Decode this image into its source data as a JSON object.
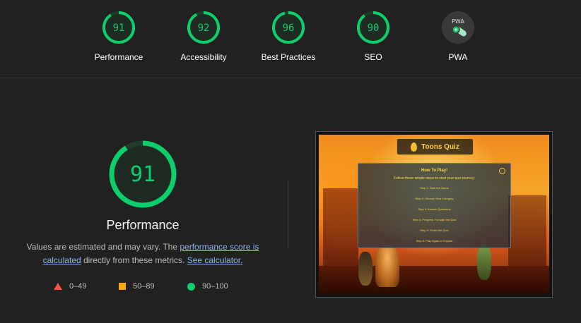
{
  "categories": [
    {
      "label": "Performance",
      "score": "91",
      "fraction": 0.91
    },
    {
      "label": "Accessibility",
      "score": "92",
      "fraction": 0.92
    },
    {
      "label": "Best Practices",
      "score": "96",
      "fraction": 0.96
    },
    {
      "label": "SEO",
      "score": "90",
      "fraction": 0.9
    },
    {
      "label": "PWA",
      "badge": "PWA"
    }
  ],
  "main": {
    "score": "91",
    "fraction": 0.91,
    "title": "Performance",
    "desc_prefix": "Values are estimated and may vary. The ",
    "desc_link1": "performance score is calculated",
    "desc_middle": " directly from these metrics. ",
    "desc_link2": "See calculator."
  },
  "legend": [
    {
      "range": "0–49",
      "color": "#ff4e42",
      "icon": "triangle-icon"
    },
    {
      "range": "50–89",
      "color": "#ffa400",
      "icon": "square-icon"
    },
    {
      "range": "90–100",
      "color": "#0cce6b",
      "icon": "circle-icon"
    }
  ],
  "screenshot": {
    "title": "Toons Quiz",
    "heading": "How To Play!",
    "subheading": "Follow these simple steps to start your quiz journey:",
    "steps": [
      "Step 1: Start the Game",
      "Step 2: Choose Your Category",
      "Step 3: Answer Questions",
      "Step 4: Progress Through the Quiz",
      "Step 5: Finish the Quiz",
      "Step 6: Play Again or Explore"
    ]
  },
  "colors": {
    "pass": "#0cce6b",
    "average": "#ffa400",
    "fail": "#ff4e42"
  }
}
